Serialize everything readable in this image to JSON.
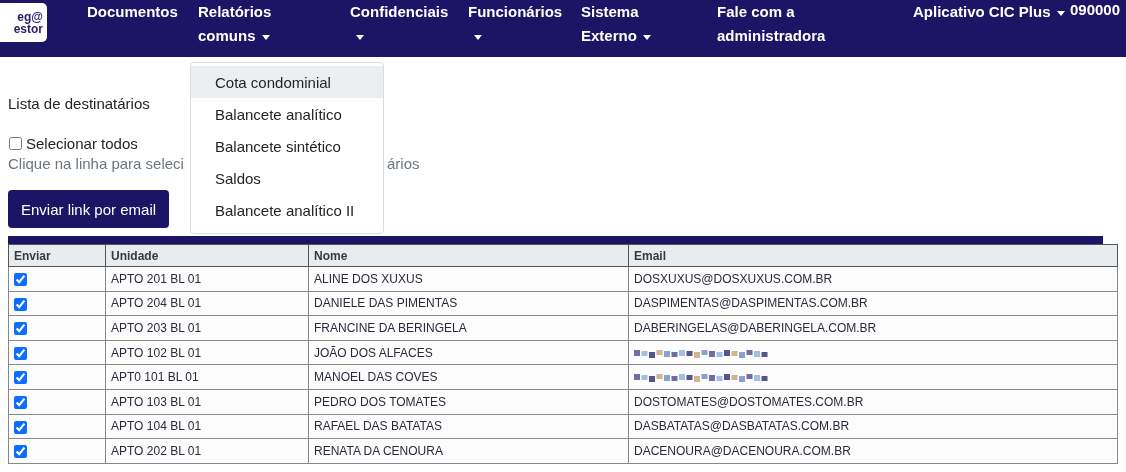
{
  "logo": {
    "lines": [
      "eg@",
      "estor"
    ]
  },
  "nav": [
    {
      "label": "Documentos",
      "dropdown": false
    },
    {
      "label": "Relatórios comuns",
      "dropdown": true
    },
    {
      "label": "Confidenciais",
      "dropdown": true
    },
    {
      "label": "Funcionários",
      "dropdown": true
    },
    {
      "label": "Sistema Externo",
      "dropdown": true
    },
    {
      "label": "Fale com a administradora",
      "dropdown": false
    },
    {
      "label": "Aplicativo CIC Plus",
      "dropdown": true
    },
    {
      "label": "090000",
      "dropdown": false
    }
  ],
  "dropdown_menu": [
    {
      "label": "Cota condominial",
      "highlighted": true
    },
    {
      "label": "Balancete analítico",
      "highlighted": false
    },
    {
      "label": "Balancete sintético",
      "highlighted": false
    },
    {
      "label": "Saldos",
      "highlighted": false
    },
    {
      "label": "Balancete analítico II",
      "highlighted": false
    }
  ],
  "list_title": "Lista de destinatários",
  "select_all": {
    "label": "Selecionar todos",
    "checked": false
  },
  "hint": [
    "Clique na linha para seleci",
    "ários"
  ],
  "send_button": "Enviar link por email",
  "table": {
    "columns": [
      "Enviar",
      "Unidade",
      "Nome",
      "Email"
    ],
    "rows": [
      {
        "checked": true,
        "unit": "APTO 201 BL 01",
        "name": "ALINE DOS XUXUS",
        "email": "DOSXUXUS@DOSXUXUS.COM.BR",
        "redacted": false
      },
      {
        "checked": true,
        "unit": "APTO 204 BL 01",
        "name": "DANIELE DAS PIMENTAS",
        "email": "DASPIMENTAS@DASPIMENTAS.COM.BR",
        "redacted": false
      },
      {
        "checked": true,
        "unit": "APTO 203 BL 01",
        "name": "FRANCINE DA BERINGELA",
        "email": "DABERINGELAS@DABERINGELA.COM.BR",
        "redacted": false
      },
      {
        "checked": true,
        "unit": "APTO 102 BL 01",
        "name": "JOÃO DOS ALFACES",
        "redacted": true
      },
      {
        "checked": true,
        "unit": "APT0 101 BL 01",
        "name": "MANOEL DAS COVES",
        "redacted": true
      },
      {
        "checked": true,
        "unit": "APTO 103 BL 01",
        "name": "PEDRO DOS TOMATES",
        "email": "DOSTOMATES@DOSTOMATES.COM.BR",
        "redacted": false
      },
      {
        "checked": true,
        "unit": "APTO 104 BL 01",
        "name": "RAFAEL DAS BATATAS",
        "email": "DASBATATAS@DASBATATAS.COM.BR",
        "redacted": false
      },
      {
        "checked": true,
        "unit": "APTO 202 BL 01",
        "name": "RENATA DA CENOURA",
        "email": "DACENOURA@DACENOURA.COM.BR",
        "redacted": false
      }
    ]
  }
}
